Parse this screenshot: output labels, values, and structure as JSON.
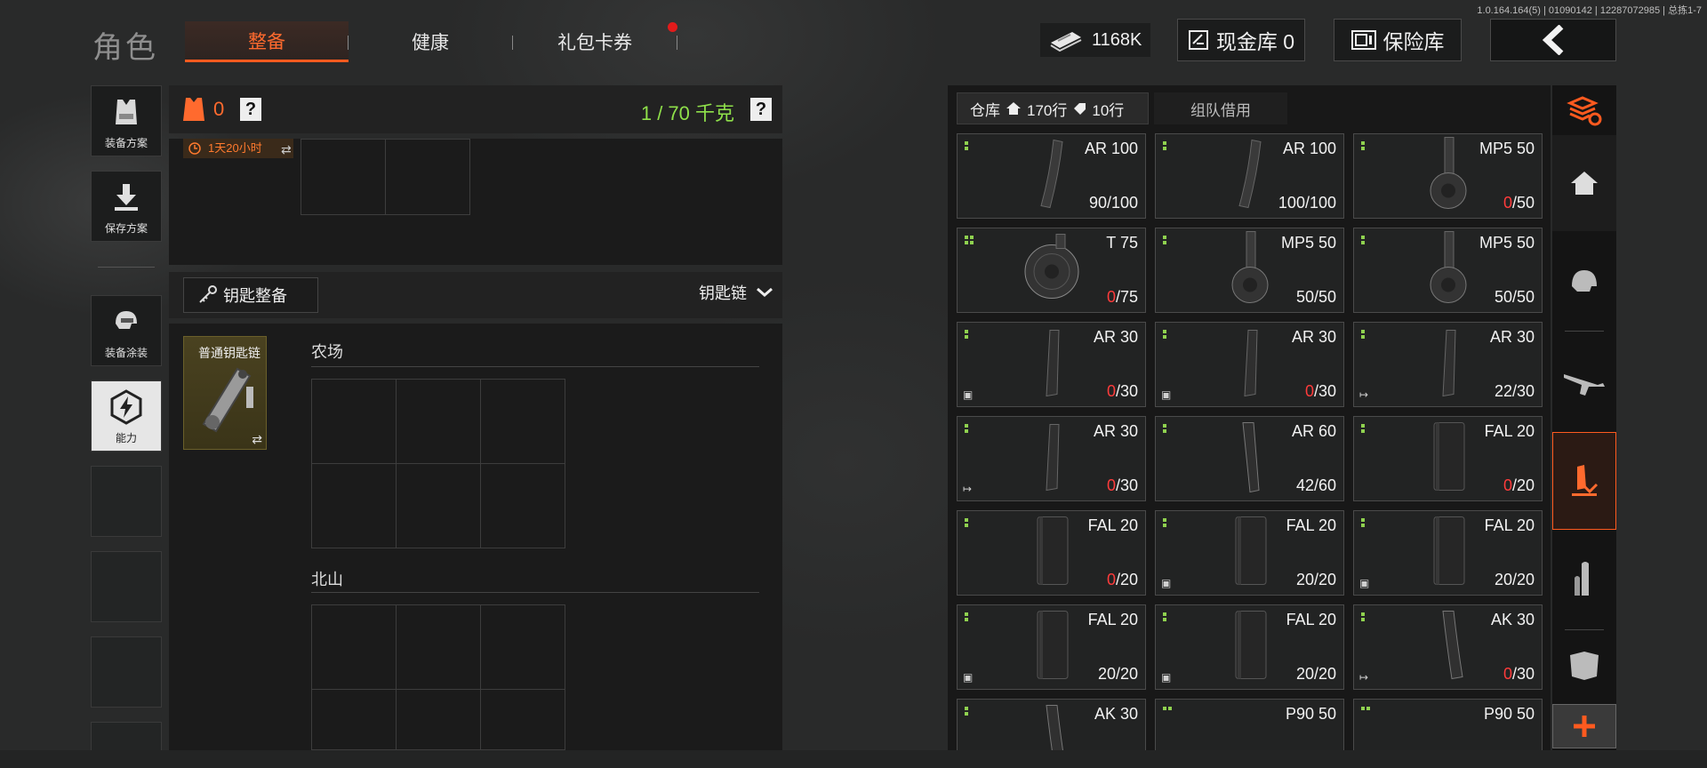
{
  "version": "1.0.164.164(5) | 01090142 | 12287072985 | 总拣1-7",
  "title": "角色",
  "tabs": [
    {
      "label": "整备",
      "active": true
    },
    {
      "label": "健康",
      "active": false
    },
    {
      "label": "礼包卡券",
      "active": false
    }
  ],
  "currency": {
    "icon": "cash-stack-icon",
    "amount": "1168K"
  },
  "cash_vault_label": "现金库 0",
  "safe_label": "保险库",
  "left_sidebar": [
    {
      "label": "装备方案",
      "icon": "vest-icon"
    },
    {
      "label": "保存方案",
      "icon": "download-icon"
    },
    {
      "label": "装备涂装",
      "icon": "helmet-paint-icon"
    },
    {
      "label": "能力",
      "icon": "ability-hex-icon"
    }
  ],
  "loadout": {
    "armor_count": "0",
    "help": "?",
    "weight": "1 / 70 千克",
    "timer": "1天20小时",
    "keychain_button": "钥匙整备",
    "keychain_dropdown": "钥匙链",
    "keychain_item": "普通钥匙链",
    "sections": [
      "农场",
      "北山"
    ]
  },
  "storage": {
    "tab_label": "仓库",
    "rows_home": "170行",
    "rows_tag": "10行",
    "team_tab": "组队借用",
    "colors": {
      "red": "#ff3b3b",
      "green": "#8fd14f"
    },
    "items": [
      {
        "name": "AR 100",
        "count": "90/100",
        "red_part": "",
        "rest": "90/100",
        "dots": 1,
        "badge": "",
        "shape": "curved"
      },
      {
        "name": "AR 100",
        "count": "100/100",
        "red_part": "",
        "rest": "100/100",
        "dots": 1,
        "badge": "",
        "shape": "curved"
      },
      {
        "name": "MP5 50",
        "count": "0/50",
        "red_part": "0",
        "rest": "/50",
        "dots": 1,
        "badge": "",
        "shape": "drum"
      },
      {
        "name": "T 75",
        "count": "0/75",
        "red_part": "0",
        "rest": "/75",
        "dots": 4,
        "badge": "",
        "shape": "bigdrum"
      },
      {
        "name": "MP5 50",
        "count": "50/50",
        "red_part": "",
        "rest": "50/50",
        "dots": 1,
        "badge": "",
        "shape": "drum"
      },
      {
        "name": "MP5 50",
        "count": "50/50",
        "red_part": "",
        "rest": "50/50",
        "dots": 1,
        "badge": "",
        "shape": "drum"
      },
      {
        "name": "AR 30",
        "count": "0/30",
        "red_part": "0",
        "rest": "/30",
        "dots": 1,
        "badge": "box",
        "shape": "stick"
      },
      {
        "name": "AR 30",
        "count": "0/30",
        "red_part": "0",
        "rest": "/30",
        "dots": 1,
        "badge": "box",
        "shape": "stick"
      },
      {
        "name": "AR 30",
        "count": "22/30",
        "red_part": "",
        "rest": "22/30",
        "dots": 1,
        "badge": "arrow",
        "shape": "stick"
      },
      {
        "name": "AR 30",
        "count": "0/30",
        "red_part": "0",
        "rest": "/30",
        "dots": 1,
        "badge": "arrow",
        "shape": "stick"
      },
      {
        "name": "AR 60",
        "count": "42/60",
        "red_part": "",
        "rest": "42/60",
        "dots": 1,
        "badge": "",
        "shape": "longstick"
      },
      {
        "name": "FAL 20",
        "count": "0/20",
        "red_part": "0",
        "rest": "/20",
        "dots": 1,
        "badge": "",
        "shape": "box"
      },
      {
        "name": "FAL 20",
        "count": "0/20",
        "red_part": "0",
        "rest": "/20",
        "dots": 1,
        "badge": "",
        "shape": "box"
      },
      {
        "name": "FAL 20",
        "count": "20/20",
        "red_part": "",
        "rest": "20/20",
        "dots": 1,
        "badge": "box",
        "shape": "box"
      },
      {
        "name": "FAL 20",
        "count": "20/20",
        "red_part": "",
        "rest": "20/20",
        "dots": 1,
        "badge": "box",
        "shape": "box"
      },
      {
        "name": "FAL 20",
        "count": "20/20",
        "red_part": "",
        "rest": "20/20",
        "dots": 1,
        "badge": "box",
        "shape": "box"
      },
      {
        "name": "FAL 20",
        "count": "20/20",
        "red_part": "",
        "rest": "20/20",
        "dots": 1,
        "badge": "box",
        "shape": "box"
      },
      {
        "name": "AK 30",
        "count": "0/30",
        "red_part": "0",
        "rest": "/30",
        "dots": 1,
        "badge": "arrow",
        "shape": "akcurve"
      },
      {
        "name": "AK 30",
        "count": "",
        "red_part": "",
        "rest": "",
        "dots": 1,
        "badge": "",
        "shape": "akcurve"
      },
      {
        "name": "P90 50",
        "count": "",
        "red_part": "",
        "rest": "",
        "dots": 2,
        "badge": "",
        "shape": "p90"
      },
      {
        "name": "P90 50",
        "count": "",
        "red_part": "",
        "rest": "",
        "dots": 2,
        "badge": "",
        "shape": "p90"
      }
    ]
  },
  "right_tabs": [
    "stack-refresh-icon",
    "home-icon",
    "helmet-icon",
    "rifle-icon",
    "ammo-down-icon",
    "bullet-icon",
    "armor-plate-icon",
    "plus-icon"
  ]
}
